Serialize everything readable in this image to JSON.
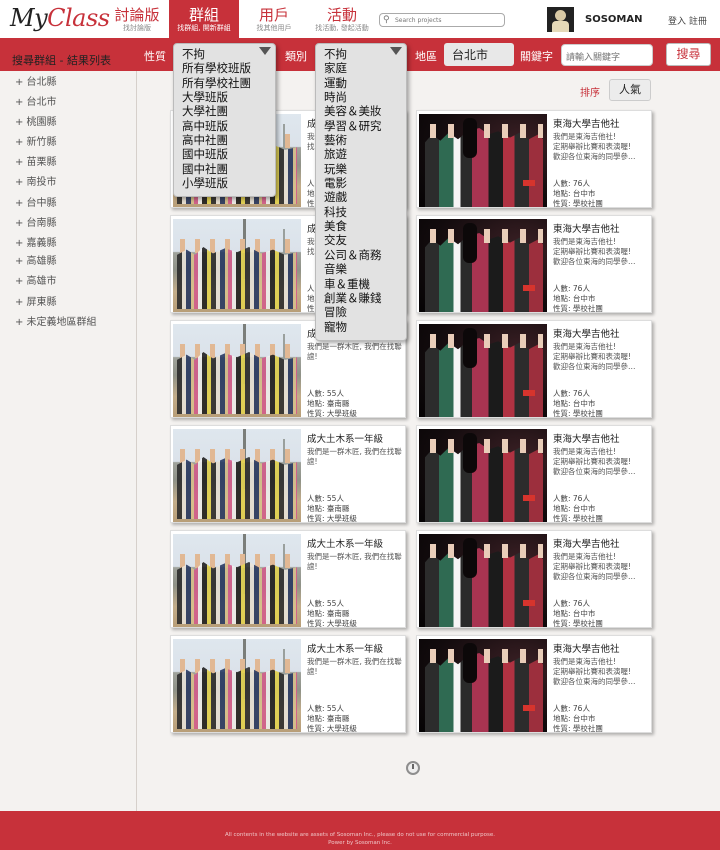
{
  "header": {
    "logo_my": "My",
    "logo_class": "Class",
    "nav": [
      {
        "label": "討論版",
        "sub": "找討論版"
      },
      {
        "label": "群組",
        "sub": "找群組, 開新群組"
      },
      {
        "label": "用戶",
        "sub": "找其他用戶"
      },
      {
        "label": "活動",
        "sub": "找活動, 發起活動"
      }
    ],
    "search_placeholder": "Search projects",
    "username": "SOSOMAN",
    "auth": "登入 註冊"
  },
  "filters": {
    "nature_label": "性質",
    "category_label": "類別",
    "region_label": "地區",
    "region_value": "台北市",
    "keyword_label": "關鍵字",
    "keyword_placeholder": "請輸入關鍵字",
    "search_button": "搜尋",
    "nature_options": [
      "不拘",
      "所有學校班版",
      "所有學校社團",
      "大學班版",
      "大學社團",
      "高中班版",
      "高中社團",
      "國中班版",
      "國中社團",
      "小學班版"
    ],
    "category_options": [
      "不拘",
      "家庭",
      "運動",
      "時尚",
      "美容＆美妝",
      "學習＆研究",
      "藝術",
      "旅遊",
      "玩樂",
      "電影",
      "遊戲",
      "科技",
      "美食",
      "交友",
      "公司＆商務",
      "音樂",
      "車＆重機",
      "創業＆賺錢",
      "冒險",
      "寵物"
    ]
  },
  "sidebar": {
    "title": "搜尋群組 - 結果列表",
    "regions": [
      "+ 台北縣",
      "+ 台北市",
      "+ 桃園縣",
      "+ 新竹縣",
      "+ 苗栗縣",
      "+ 南投市",
      "+ 台中縣",
      "+ 台南縣",
      "+ 嘉義縣",
      "+ 高雄縣",
      "+ 高雄市",
      "+ 屏東縣",
      "+ 未定義地區群組"
    ]
  },
  "sort": {
    "label": "排序",
    "value": "人氣"
  },
  "cards": {
    "left": [
      {
        "title": "成",
        "desc": "我們\n找",
        "meta": [
          "人",
          "地",
          "性"
        ]
      },
      {
        "title": "成",
        "desc": "我們\n找",
        "meta": [
          "人",
          "地",
          "性"
        ]
      },
      {
        "title": "成",
        "desc": "我們是一群木匠, 我們在找聯誼!",
        "meta": [
          "人數: 55人",
          "地點: 臺南縣",
          "性質: 大學班級"
        ]
      },
      {
        "title": "成大土木系一年級",
        "desc": "我們是一群木匠, 我們在找聯誼!",
        "meta": [
          "人數: 55人",
          "地點: 臺南縣",
          "性質: 大學班級"
        ]
      },
      {
        "title": "成大土木系一年級",
        "desc": "我們是一群木匠, 我們在找聯誼!",
        "meta": [
          "人數: 55人",
          "地點: 臺南縣",
          "性質: 大學班級"
        ]
      },
      {
        "title": "成大土木系一年級",
        "desc": "我們是一群木匠, 我們在找聯誼!",
        "meta": [
          "人數: 55人",
          "地點: 臺南縣",
          "性質: 大學班級"
        ]
      }
    ],
    "right": [
      {
        "title": "東海大學吉他社",
        "desc": "我們是東海吉他社!\n定期舉辦比賽和表演喔!\n歡迎各位東海的同學參…",
        "meta": [
          "人數: 76人",
          "地點: 台中市",
          "性質: 學校社團"
        ]
      },
      {
        "title": "東海大學吉他社",
        "desc": "我們是東海吉他社!\n定期舉辦比賽和表演喔!\n歡迎各位東海的同學參…",
        "meta": [
          "人數: 76人",
          "地點: 台中市",
          "性質: 學校社團"
        ]
      },
      {
        "title": "東海大學吉他社",
        "desc": "我們是東海吉他社!\n定期舉辦比賽和表演喔!\n歡迎各位東海的同學參…",
        "meta": [
          "人數: 76人",
          "地點: 台中市",
          "性質: 學校社團"
        ]
      },
      {
        "title": "東海大學吉他社",
        "desc": "我們是東海吉他社!\n定期舉辦比賽和表演喔!\n歡迎各位東海的同學參…",
        "meta": [
          "人數: 76人",
          "地點: 台中市",
          "性質: 學校社團"
        ]
      },
      {
        "title": "東海大學吉他社",
        "desc": "我們是東海吉他社!\n定期舉辦比賽和表演喔!\n歡迎各位東海的同學參…",
        "meta": [
          "人數: 76人",
          "地點: 台中市",
          "性質: 學校社團"
        ]
      },
      {
        "title": "東海大學吉他社",
        "desc": "我們是東海吉他社!\n定期舉辦比賽和表演喔!\n歡迎各位東海的同學參…",
        "meta": [
          "人數: 76人",
          "地點: 台中市",
          "性質: 學校社團"
        ]
      }
    ]
  },
  "footer": {
    "line1": "All contents in the website are assets of Sosoman Inc., please do not use for commercial purpose.",
    "line2": "Power by Sosoman Inc."
  },
  "colors": {
    "brand_red": "#c7313a",
    "background": "#f4f2f0"
  },
  "icons": [
    "search-icon",
    "chevron-down-icon",
    "loading-icon"
  ]
}
